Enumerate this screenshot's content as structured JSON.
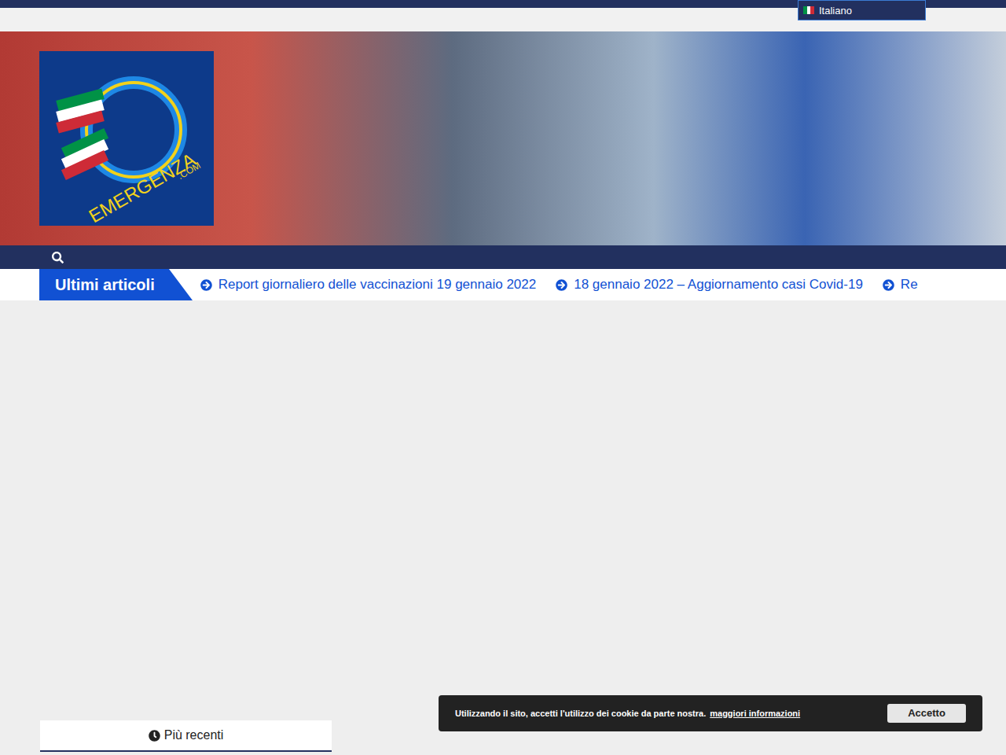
{
  "language": {
    "label": "Italiano"
  },
  "logo": {
    "text": "EMERGENZA",
    "suffix": ".COM"
  },
  "ticker": {
    "title": "Ultimi articoli",
    "items": [
      "Report giornaliero delle vaccinazioni 19 gennaio 2022",
      "18 gennaio 2022 – Aggiornamento casi Covid-19",
      "Re"
    ]
  },
  "tabs": [
    {
      "label": "Più recenti",
      "selected": true
    }
  ],
  "cookie": {
    "message": "Utilizzando il sito, accetti l'utilizzo dei cookie da parte nostra.",
    "link": "maggiori informazioni",
    "button": "Accetto"
  }
}
